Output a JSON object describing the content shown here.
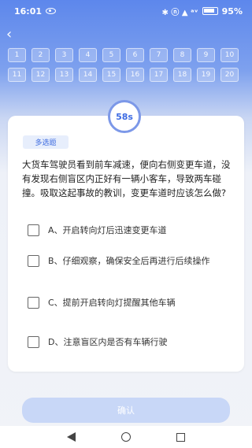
{
  "status": {
    "time": "16:01",
    "network": "✱ ⓝ ▲ ᵃᵛ",
    "battery": "95%"
  },
  "question_numbers": [
    "1",
    "2",
    "3",
    "4",
    "5",
    "6",
    "7",
    "8",
    "9",
    "10",
    "11",
    "12",
    "13",
    "14",
    "15",
    "16",
    "17",
    "18",
    "19",
    "20"
  ],
  "timer": "58s",
  "question": {
    "type": "多选题",
    "text": "大货车驾驶员看到前车减速，便向右侧变更车道，没有发现右侧盲区内正好有一辆小客车，导致两车碰撞。吸取这起事故的教训，变更车道时应该怎么做?"
  },
  "options": [
    {
      "label": "A、开启转向灯后迅速变更车道"
    },
    {
      "label": "B、仔细观察，确保安全后再进行后续操作"
    },
    {
      "label": "C、提前开启转向灯提醒其他车辆"
    },
    {
      "label": "D、注意盲区内是否有车辆行驶"
    }
  ],
  "confirm": "确认",
  "icons": {
    "back": "back-arrow-icon",
    "eye": "eye-icon",
    "battery": "battery-icon"
  }
}
